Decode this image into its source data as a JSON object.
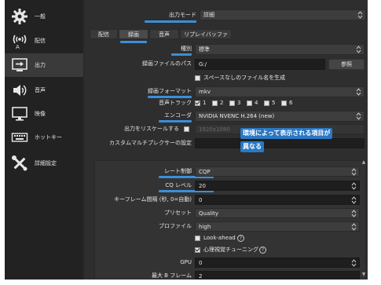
{
  "sidebar": {
    "items": [
      {
        "label": "一般",
        "icon": "gear-icon"
      },
      {
        "label": "配信",
        "icon": "broadcast-icon"
      },
      {
        "label": "出力",
        "icon": "output-icon"
      },
      {
        "label": "音声",
        "icon": "speaker-icon"
      },
      {
        "label": "映像",
        "icon": "monitor-icon"
      },
      {
        "label": "ホットキー",
        "icon": "keyboard-icon"
      },
      {
        "label": "詳細設定",
        "icon": "tools-icon"
      }
    ],
    "active_index": 2
  },
  "output_mode": {
    "label": "出力モード",
    "value": "詳細"
  },
  "tabs": [
    {
      "label": "配信"
    },
    {
      "label": "録画"
    },
    {
      "label": "音声"
    },
    {
      "label": "リプレイバッファ"
    }
  ],
  "active_tab": 1,
  "recording": {
    "type_label": "種別",
    "type_value": "標準",
    "path_label": "録画ファイルのパス",
    "path_value": "G:/",
    "browse_label": "参照",
    "no_space_label": "スペースなしのファイル名を生成",
    "format_label": "録画フォーマット",
    "format_value": "mkv",
    "audio_track_label": "音声トラック",
    "tracks": [
      "1",
      "2",
      "3",
      "4",
      "5",
      "6"
    ],
    "encoder_label": "エンコーダ",
    "encoder_value": "NVIDIA NVENC H.264 (new)",
    "rescale_label": "出力をリスケールする",
    "rescale_value": "1920x1080",
    "muxer_label": "カスタムマルチプレクサーの設定"
  },
  "callout": {
    "line1": "環境によって表示される項目が",
    "line2": "異なる"
  },
  "encoder_settings": {
    "rate_control_label": "レート制御",
    "rate_control_value": "CQP",
    "cq_label": "CQ レベル",
    "cq_value": "20",
    "keyframe_label": "キーフレーム間隔 (秒, 0=自動)",
    "keyframe_value": "0",
    "preset_label": "プリセット",
    "preset_value": "Quality",
    "profile_label": "プロファイル",
    "profile_value": "high",
    "lookahead_label": "Look-ahead",
    "psycho_label": "心理視覚チューニング",
    "gpu_label": "GPU",
    "gpu_value": "0",
    "bframes_label": "最大 B フレーム",
    "bframes_value": "2"
  },
  "colors": {
    "highlight": "#3b8fd9",
    "callout_bg": "#2a78c4"
  }
}
